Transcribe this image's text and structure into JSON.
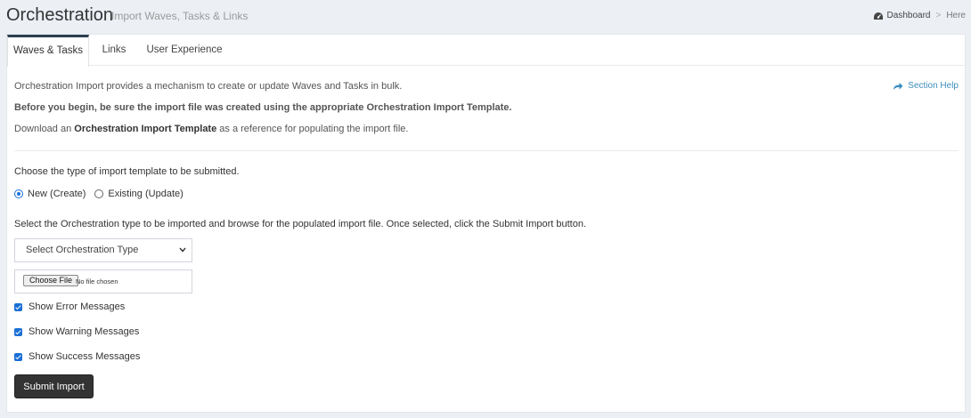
{
  "header": {
    "title": "Orchestration",
    "subtitle": "Import Waves, Tasks & Links",
    "breadcrumb": [
      "Dashboard",
      "Here"
    ],
    "breadcrumb_separator": ">",
    "breadcrumb_icon": "dashboard-icon"
  },
  "tabs": [
    {
      "label": "Waves & Tasks",
      "active": true
    },
    {
      "label": "Links",
      "active": false
    },
    {
      "label": "User Experience",
      "active": false
    }
  ],
  "intro": {
    "line1": "Orchestration Import provides a mechanism to create or update Waves and Tasks in bulk.",
    "line2": "Before you begin, be sure the import file was created using the appropriate Orchestration Import Template.",
    "line3_prefix": "Download an ",
    "line3_link": "Orchestration Import Template",
    "line3_suffix": " as a reference for populating the import file."
  },
  "help": {
    "label": "Section Help",
    "icon": "share-icon"
  },
  "template_type": {
    "prompt": "Choose the type of import template to be submitted.",
    "options": [
      {
        "label": "New (Create)",
        "checked": true
      },
      {
        "label": "Existing (Update)",
        "checked": false
      }
    ]
  },
  "orchestration": {
    "prompt": "Select the Orchestration type to be imported and browse for the populated import file. Once selected, click the Submit Import button.",
    "select_value": "Select Orchestration Type"
  },
  "file": {
    "button_label": "Choose File",
    "status": "No file chosen"
  },
  "messages": [
    {
      "label": "Show Error Messages",
      "checked": true
    },
    {
      "label": "Show Warning Messages",
      "checked": true
    },
    {
      "label": "Show Success Messages",
      "checked": true
    }
  ],
  "submit_label": "Submit Import",
  "colors": {
    "accent": "#1a6fd6",
    "link": "#3c8dbc",
    "button": "#333333",
    "background": "#ecf0f5"
  }
}
